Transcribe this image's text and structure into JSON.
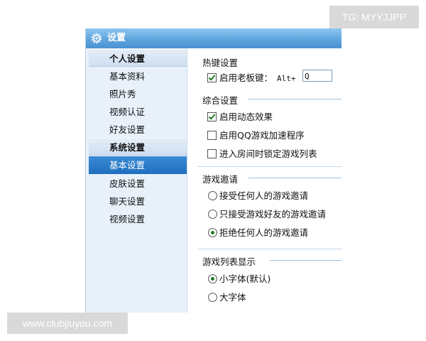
{
  "watermarks": {
    "top": "TG: MYYJJPP",
    "bottom": "www.clubjiuyou.com"
  },
  "window": {
    "title": "设置"
  },
  "sidebar": {
    "groups": [
      {
        "header": "个人设置",
        "items": [
          "基本资料",
          "照片秀",
          "视频认证",
          "好友设置"
        ]
      },
      {
        "header": "系统设置",
        "items": [
          "基本设置",
          "皮肤设置",
          "聊天设置",
          "视频设置"
        ]
      }
    ],
    "selected": "基本设置"
  },
  "content": {
    "hotkey": {
      "title": "热键设置",
      "boss_key_label": "启用老板键：",
      "boss_key_checked": true,
      "prefix": "Alt+",
      "value": "Q"
    },
    "general": {
      "title": "综合设置",
      "options": [
        {
          "label": "启用动态效果",
          "checked": true
        },
        {
          "label": "启用QQ游戏加速程序",
          "checked": false
        },
        {
          "label": "进入房间时锁定游戏列表",
          "checked": false
        }
      ]
    },
    "invite": {
      "title": "游戏邀请",
      "options": [
        {
          "label": "接受任何人的游戏邀请",
          "selected": false
        },
        {
          "label": "只接受游戏好友的游戏邀请",
          "selected": false
        },
        {
          "label": "拒绝任何人的游戏邀请",
          "selected": true
        }
      ]
    },
    "list_display": {
      "title": "游戏列表显示",
      "options": [
        {
          "label": "小字体(默认)",
          "selected": true
        },
        {
          "label": "大字体",
          "selected": false
        }
      ]
    }
  },
  "colors": {
    "titlebar": "#5ea5de",
    "sidebar_bg": "#e8f1fa",
    "selected_bg": "#2b7cc9",
    "check_mark": "#1f7a1f"
  }
}
